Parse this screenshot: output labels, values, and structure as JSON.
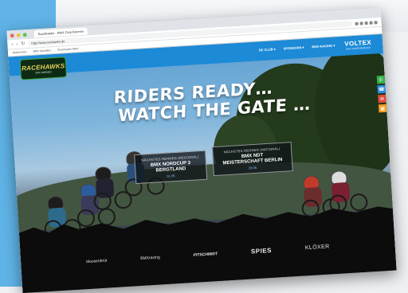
{
  "browser": {
    "tab_title": "Rachhawks - BMX Club Bremen",
    "url": "http://www.rachawks.de",
    "bookmarks": [
      "Bookmarks",
      "BMX Aktuelles",
      "Racehawks BMX"
    ]
  },
  "site": {
    "logo_text": "RACEHAWKS",
    "logo_sub": "BMX BREMEN",
    "nav": [
      "DE CLUB ▾",
      "SPONSORS ▾",
      "BMX RACING ▾"
    ],
    "brand": "VOLTEX",
    "brand_sub": "BMX PERFORMANCE",
    "headline_line1": "RIDERS READY…",
    "headline_line2": "WATCH THE GATE …",
    "events": [
      {
        "kicker": "NÄCHSTES RENNEN (REGIONAL)",
        "title": "BMX NORDCUP 3\nBERGTLAND",
        "date": "01.05."
      },
      {
        "kicker": "NÄCHSTES RENNEN (NATIONAL)",
        "title": "BMX NDT\nMEISTERSCHAFT BERLIN",
        "date": "26.05."
      }
    ],
    "sponsors": [
      "bloosenbrüt",
      "BMXracing",
      "PITSCHMIDT",
      "SPIES",
      "KLÖXER"
    ],
    "side_buttons": [
      {
        "icon": "whatsapp-icon",
        "color": "#35b04a",
        "glyph": "✆"
      },
      {
        "icon": "phone-icon",
        "color": "#2a8ee0",
        "glyph": "☎"
      },
      {
        "icon": "mail-icon",
        "color": "#e04a3a",
        "glyph": "✉"
      },
      {
        "icon": "calendar-icon",
        "color": "#f0a020",
        "glyph": "▦"
      }
    ]
  }
}
